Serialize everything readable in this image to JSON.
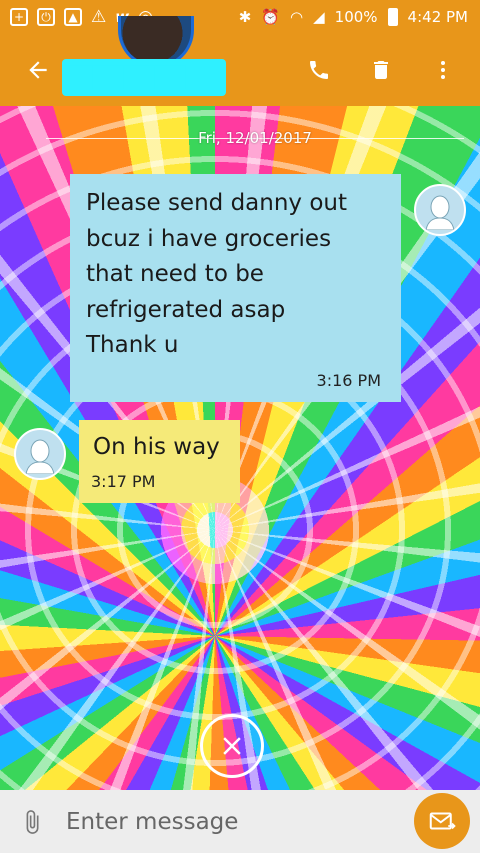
{
  "status_bar": {
    "battery_percent": "100%",
    "time": "4:42 PM",
    "icons": [
      "add-icon",
      "power-icon",
      "image-icon",
      "warning-icon",
      "w-icon",
      "at-icon",
      "bluetooth-icon",
      "alarm-icon",
      "wifi-icon",
      "signal-icon",
      "battery-icon"
    ]
  },
  "app_bar": {
    "contact_name": "████████",
    "actions": [
      "phone-icon",
      "trash-icon",
      "overflow-menu-icon"
    ],
    "colors": {
      "bar": "#e8961a"
    }
  },
  "conversation": {
    "date": "Fri, 12/01/2017",
    "messages": [
      {
        "direction": "sent",
        "text": "Please send danny out\nbcuz i have groceries\nthat need to be\nrefrigerated asap\nThank u",
        "time": "3:16 PM",
        "color": "#a8e0ef"
      },
      {
        "direction": "received",
        "text": "On his way",
        "time": "3:17 PM",
        "color": "#f5ea79"
      }
    ]
  },
  "composer": {
    "placeholder": "Enter message"
  }
}
